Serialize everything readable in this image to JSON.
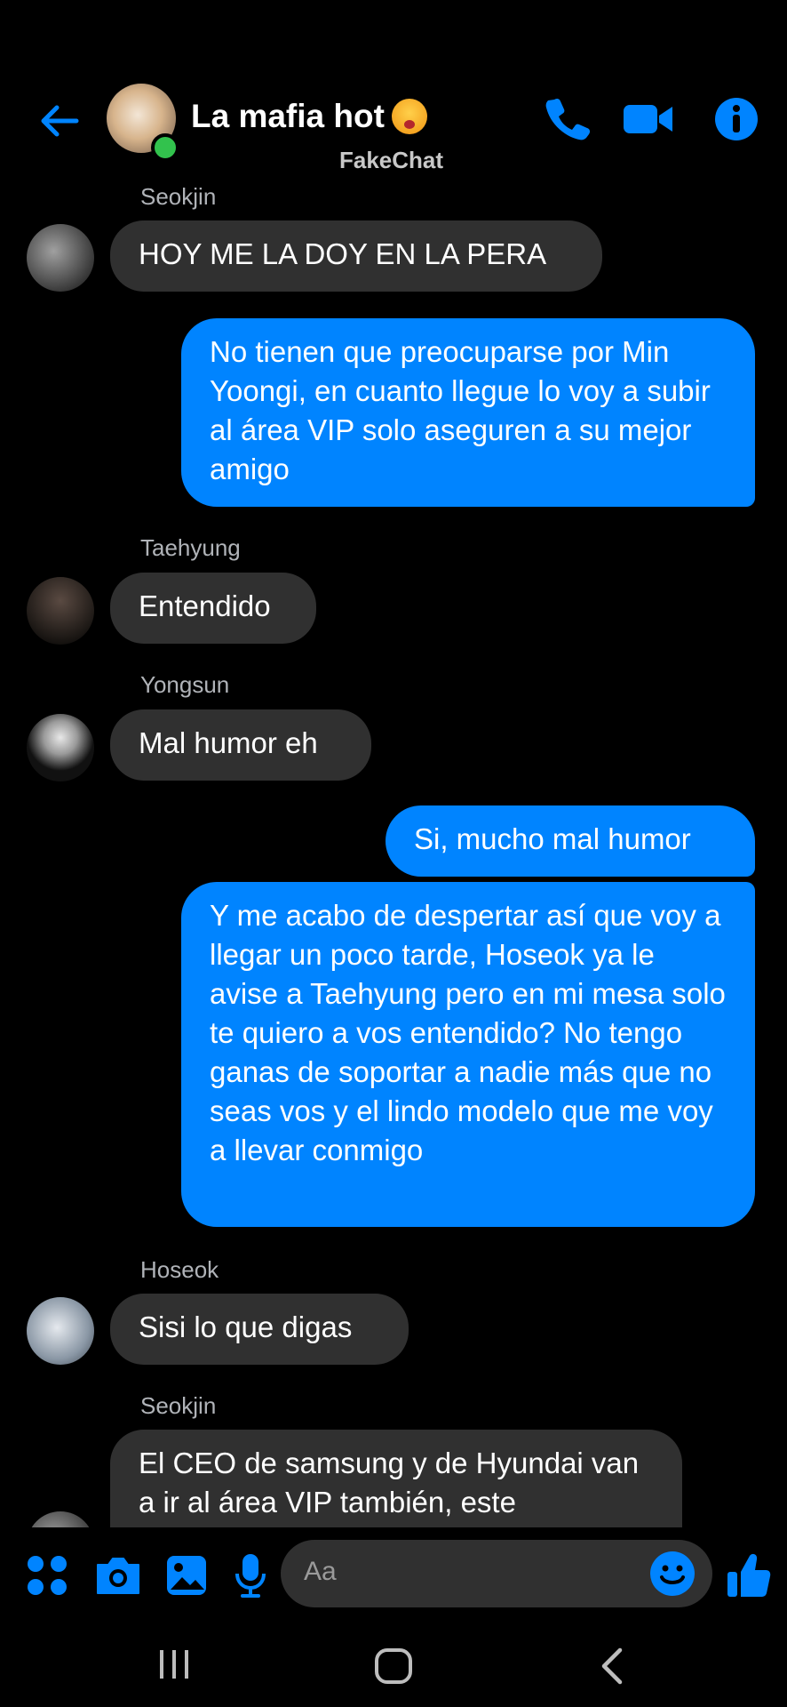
{
  "header": {
    "title": "La mafia hot",
    "watermark": "FakeChat",
    "title_emoji": "hot-face-emoji",
    "icons": [
      "back-arrow-icon",
      "phone-icon",
      "video-camera-icon",
      "info-icon"
    ],
    "accent": "#0084ff",
    "online_color": "#32c24d"
  },
  "messages": [
    {
      "sender": "Seokjin",
      "text": "HOY ME LA DOY EN LA PERA",
      "dir": "in"
    },
    {
      "text": "No tienen que preocuparse por Min Yoongi, en cuanto llegue lo voy a subir al área VIP solo aseguren a su mejor amigo",
      "dir": "out"
    },
    {
      "sender": "Taehyung",
      "text": "Entendido",
      "dir": "in"
    },
    {
      "sender": "Yongsun",
      "text": "Mal humor eh",
      "dir": "in"
    },
    {
      "text": "Si, mucho mal humor",
      "dir": "out"
    },
    {
      "text": "Y me acabo de despertar así que voy a llegar un poco tarde, Hoseok ya le avise a Taehyung pero en mi mesa solo te quiero a vos entendido? No tengo ganas de soportar a nadie más que no seas vos y el lindo modelo que me voy a llevar conmigo",
      "dir": "out"
    },
    {
      "sender": "Hoseok",
      "text": "Sisi lo que digas",
      "dir": "in"
    },
    {
      "sender": "Seokjin",
      "text": "El CEO de samsung y de Hyundai van a ir al área VIP también, este",
      "dir": "in"
    }
  ],
  "composer": {
    "placeholder": "Aa",
    "icons": [
      "apps-grid-icon",
      "camera-icon",
      "gallery-icon",
      "microphone-icon",
      "emoji-icon",
      "thumbs-up-icon"
    ]
  },
  "navbar": {
    "icons": [
      "recent-apps-icon",
      "home-icon",
      "back-icon"
    ]
  },
  "colors": {
    "bubble_in": "#303030",
    "bubble_out": "#0084ff",
    "background": "#000000",
    "sender_text": "#b0b3b8"
  }
}
